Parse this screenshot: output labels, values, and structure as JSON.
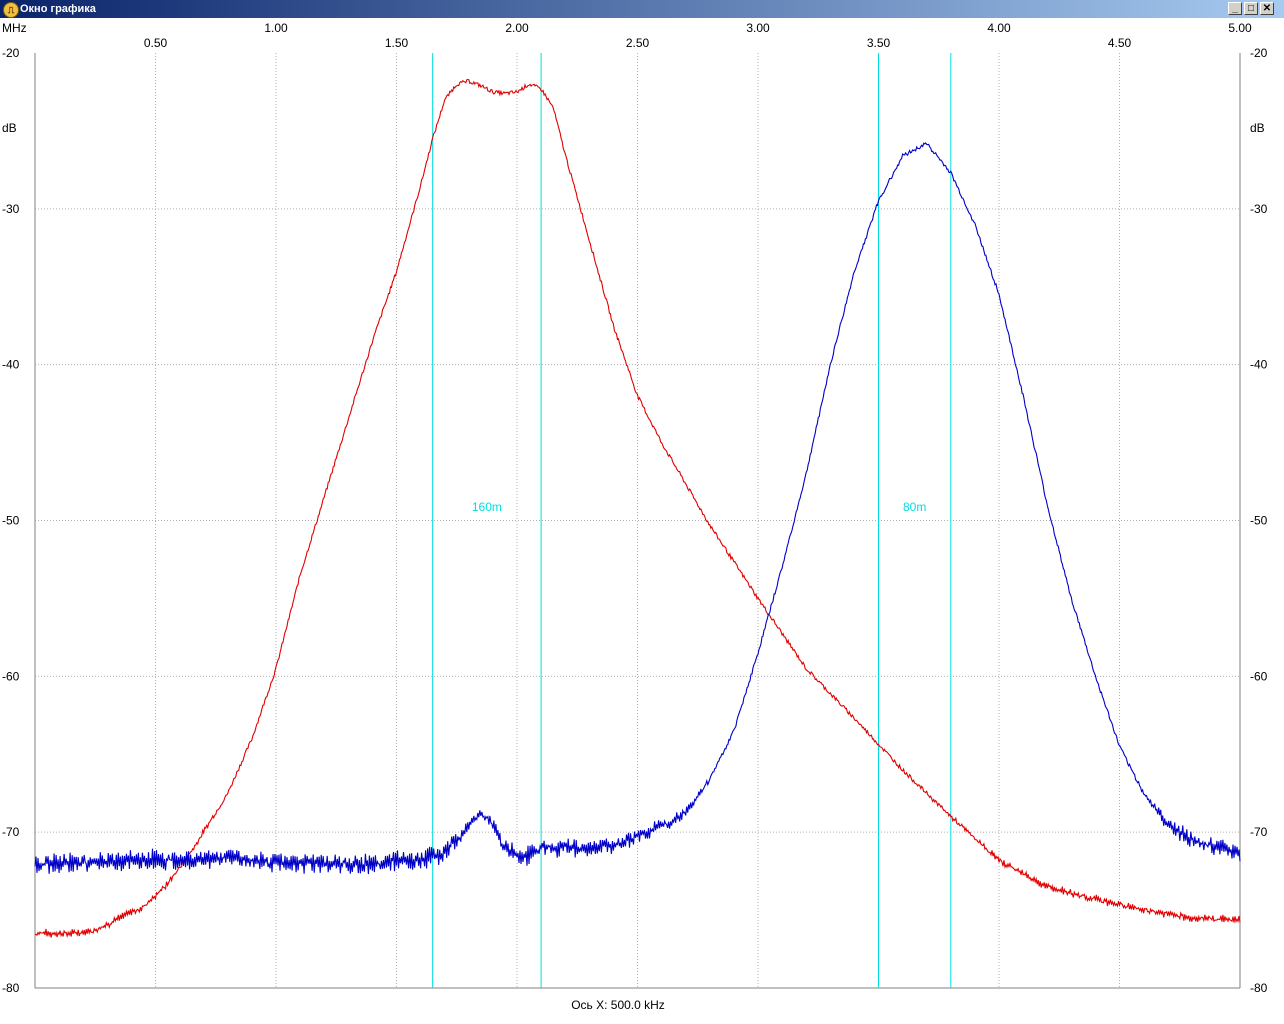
{
  "window": {
    "title": "Окно графика",
    "icon": "oscilloscope-icon",
    "controls": [
      "_",
      "□",
      "✕"
    ]
  },
  "chart_data": {
    "type": "line",
    "x_unit": "MHz",
    "y_unit": "dB",
    "xlim": [
      0.0,
      5.0
    ],
    "ylim": [
      -80,
      -20
    ],
    "x_ticks_top": [
      "1.00",
      "2.00",
      "3.00",
      "4.00",
      "5.00"
    ],
    "x_ticks_bottom": [
      "0.50",
      "1.50",
      "2.50",
      "3.50",
      "4.50"
    ],
    "y_ticks": [
      "-20",
      "-30",
      "-40",
      "-50",
      "-60",
      "-70",
      "-80"
    ],
    "grid": true,
    "x_axis_caption": "Ось X: 500.0 kHz",
    "markers": [
      {
        "label": "160m",
        "from": 1.65,
        "to": 2.1,
        "color": "#00e0e0"
      },
      {
        "label": "80m",
        "from": 3.5,
        "to": 3.8,
        "color": "#00e0e0"
      }
    ],
    "series": [
      {
        "color": "#e00000",
        "noise_below": 0.5,
        "x": [
          0.0,
          0.15,
          0.25,
          0.35,
          0.45,
          0.55,
          0.65,
          0.8,
          0.9,
          1.0,
          1.1,
          1.2,
          1.3,
          1.4,
          1.5,
          1.6,
          1.65,
          1.7,
          1.75,
          1.8,
          1.85,
          1.9,
          1.95,
          2.0,
          2.05,
          2.1,
          2.15,
          2.2,
          2.3,
          2.4,
          2.5,
          2.6,
          2.8,
          3.0,
          3.2,
          3.4,
          3.6,
          3.8,
          4.0,
          4.2,
          4.4,
          4.6,
          4.8,
          5.0
        ],
        "y": [
          -76.5,
          -76.5,
          -76.3,
          -75.5,
          -74.8,
          -73.3,
          -71.2,
          -67.5,
          -64.0,
          -59.5,
          -53.5,
          -48.5,
          -43.5,
          -38.5,
          -34.0,
          -28.5,
          -25.5,
          -23.0,
          -22.0,
          -21.8,
          -22.1,
          -22.5,
          -22.6,
          -22.5,
          -22.0,
          -22.3,
          -23.5,
          -26.5,
          -32.0,
          -37.5,
          -42.0,
          -45.0,
          -50.3,
          -55.0,
          -59.5,
          -62.7,
          -66.0,
          -69.0,
          -71.8,
          -73.5,
          -74.3,
          -75.0,
          -75.5,
          -75.6
        ]
      },
      {
        "color": "#0000c8",
        "noise_below": 2.5,
        "x": [
          0.0,
          0.2,
          0.4,
          0.6,
          0.8,
          1.0,
          1.2,
          1.4,
          1.6,
          1.7,
          1.75,
          1.8,
          1.85,
          1.9,
          1.95,
          2.0,
          2.05,
          2.1,
          2.2,
          2.3,
          2.4,
          2.5,
          2.6,
          2.7,
          2.8,
          2.9,
          3.0,
          3.1,
          3.2,
          3.3,
          3.4,
          3.5,
          3.6,
          3.7,
          3.8,
          3.9,
          4.0,
          4.1,
          4.2,
          4.3,
          4.4,
          4.5,
          4.6,
          4.7,
          4.8,
          4.9,
          5.0
        ],
        "y": [
          -72.0,
          -72.0,
          -71.8,
          -71.8,
          -71.6,
          -72.0,
          -72.0,
          -72.0,
          -71.8,
          -71.3,
          -70.5,
          -69.5,
          -68.8,
          -69.5,
          -71.0,
          -71.6,
          -71.5,
          -71.0,
          -71.0,
          -71.0,
          -70.8,
          -70.3,
          -69.6,
          -68.7,
          -66.6,
          -63.5,
          -58.5,
          -53.0,
          -47.0,
          -40.0,
          -34.0,
          -29.5,
          -26.6,
          -25.8,
          -27.7,
          -31.0,
          -35.5,
          -42.0,
          -49.0,
          -55.0,
          -60.0,
          -64.5,
          -67.5,
          -69.5,
          -70.5,
          -71.0,
          -71.3
        ]
      }
    ]
  }
}
